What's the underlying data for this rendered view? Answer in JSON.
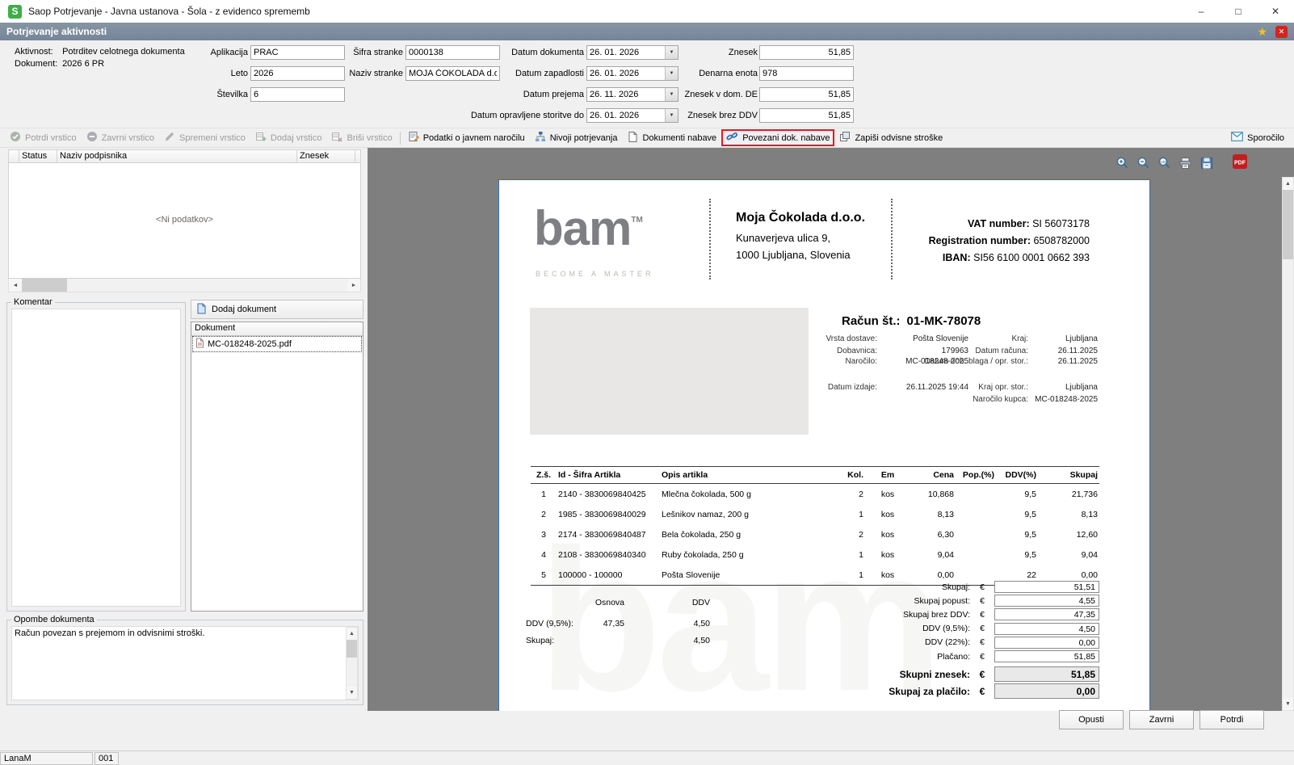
{
  "window": {
    "title": "Saop Potrjevanje - Javna ustanova - Šola - z evidenco sprememb",
    "app_initial": "S"
  },
  "header": {
    "title": "Potrjevanje aktivnosti"
  },
  "icons": {
    "minimize": "–",
    "maximize": "□",
    "close": "✕",
    "star": "★",
    "exit": "✕",
    "dropdown": "▼",
    "up": "▲",
    "down": "▼",
    "left": "◄",
    "right": "►"
  },
  "form": {
    "aktivnost_label": "Aktivnost:",
    "aktivnost": "Potrditev celotnega dokumenta",
    "dokument_label": "Dokument:",
    "dokument": "2026 6 PR",
    "aplikacija_label": "Aplikacija",
    "aplikacija": "PRAC",
    "leto_label": "Leto",
    "leto": "2026",
    "stevilka_label": "Številka",
    "stevilka": "6",
    "sifra_stranke_label": "Šifra stranke",
    "sifra_stranke": "0000138",
    "naziv_stranke_label": "Naziv stranke",
    "naziv_stranke": "MOJA ČOKOLADA d.o.o",
    "datum_dokumenta_label": "Datum dokumenta",
    "datum_dokumenta": "26. 01. 2026",
    "datum_zapadlosti_label": "Datum zapadlosti",
    "datum_zapadlosti": "26. 01. 2026",
    "datum_prejema_label": "Datum prejema",
    "datum_prejema": "26. 11. 2026",
    "datum_storitve_label": "Datum opravljene storitve do",
    "datum_storitve": "26. 01. 2026",
    "znesek_label": "Znesek",
    "znesek": "51,85",
    "denarna_enota_label": "Denarna enota",
    "denarna_enota": "978",
    "znesek_dom_label": "Znesek v dom. DE",
    "znesek_dom": "51,85",
    "znesek_brez_ddv_label": "Znesek brez DDV",
    "znesek_brez_ddv": "51,85"
  },
  "toolbar": {
    "potrdi_vrstico": "Potrdi vrstico",
    "zavrni_vrstico": "Zavrni vrstico",
    "spremeni_vrstico": "Spremeni vrstico",
    "dodaj_vrstico": "Dodaj vrstico",
    "brisi_vrstico": "Briši vrstico",
    "podatki_narocilo": "Podatki o javnem naročilu",
    "nivoji": "Nivoji potrjevanja",
    "dokumenti_nabave": "Dokumenti nabave",
    "povezani_dok": "Povezani dok. nabave",
    "zapisi_stroske": "Zapiši odvisne stroške",
    "sporocilo": "Sporočilo"
  },
  "signers": {
    "columns": [
      "Status",
      "Naziv podpisnika",
      "Znesek"
    ],
    "empty_text": "<Ni podatkov>"
  },
  "komentar": {
    "label": "Komentar"
  },
  "documents": {
    "add_button": "Dodaj dokument",
    "column": "Dokument",
    "items": [
      "MC-018248-2025.pdf"
    ]
  },
  "opombe": {
    "label": "Opombe dokumenta",
    "text": "Račun povezan s prejemom in odvisnimi stroški."
  },
  "invoice": {
    "logo_text": "bam",
    "logo_tm": "TM",
    "logo_tagline": "BECOME A MASTER",
    "company": {
      "name": "Moja Čokolada d.o.o.",
      "street": "Kunaverjeva ulica 9,",
      "city": "1000 Ljubljana, Slovenia"
    },
    "ids": {
      "vat_label": "VAT number:",
      "vat": "SI 56073178",
      "reg_label": "Registration number:",
      "reg": "6508782000",
      "iban_label": "IBAN:",
      "iban": "SI56 6100 0001 0662 393"
    },
    "title_label": "Račun št.:",
    "number": "01-MK-78078",
    "meta_left": [
      {
        "label": "Vrsta dostave:",
        "value": "Pošta Slovenije"
      },
      {
        "label": "Dobavnica:",
        "value": "179963"
      },
      {
        "label": "Naročilo:",
        "value": "MC-018248-2025"
      },
      {
        "label": "Datum izdaje:",
        "value": "26.11.2025 19:44"
      }
    ],
    "meta_right": [
      {
        "label": "Kraj:",
        "value": "Ljubljana"
      },
      {
        "label": "Datum računa:",
        "value": "26.11.2025"
      },
      {
        "label": "Datum dob. blaga / opr. stor.:",
        "value": "26.11.2025"
      },
      {
        "label": "Kraj opr. stor.:",
        "value": "Ljubljana"
      },
      {
        "label": "Naročilo kupca:",
        "value": "MC-018248-2025"
      }
    ],
    "table": {
      "headers": [
        "Z.š.",
        "Id - Šifra Artikla",
        "Opis artikla",
        "Kol.",
        "Em",
        "Cena",
        "Pop.(%)",
        "DDV(%)",
        "Skupaj"
      ],
      "rows": [
        [
          "1",
          "2140 - 3830069840425",
          "Mlečna čokolada, 500 g",
          "2",
          "kos",
          "10,868",
          "",
          "9,5",
          "21,736"
        ],
        [
          "2",
          "1985 - 3830069840029",
          "Lešnikov namaz, 200 g",
          "1",
          "kos",
          "8,13",
          "",
          "9,5",
          "8,13"
        ],
        [
          "3",
          "2174 - 3830069840487",
          "Bela čokolada, 250 g",
          "2",
          "kos",
          "6,30",
          "",
          "9,5",
          "12,60"
        ],
        [
          "4",
          "2108 - 3830069840340",
          "Ruby čokolada, 250 g",
          "1",
          "kos",
          "9,04",
          "",
          "9,5",
          "9,04"
        ],
        [
          "5",
          "100000 - 100000",
          "Pošta Slovenije",
          "1",
          "kos",
          "0,00",
          "",
          "22",
          "0,00"
        ]
      ]
    },
    "vat_summary": {
      "osnova_header": "Osnova",
      "ddv_header": "DDV",
      "rows": [
        {
          "label": "DDV (9,5%):",
          "osnova": "47,35",
          "ddv": "4,50"
        },
        {
          "label": "Skupaj:",
          "osnova": "",
          "ddv": "4,50"
        }
      ]
    },
    "totals": [
      {
        "label": "Skupaj:",
        "currency": "€",
        "value": "51,51"
      },
      {
        "label": "Skupaj popust:",
        "currency": "€",
        "value": "4,55"
      },
      {
        "label": "Skupaj brez DDV:",
        "currency": "€",
        "value": "47,35"
      },
      {
        "label": "DDV (9,5%):",
        "currency": "€",
        "value": "4,50"
      },
      {
        "label": "DDV (22%):",
        "currency": "€",
        "value": "0,00"
      },
      {
        "label": "Plačano:",
        "currency": "€",
        "value": "51,85"
      },
      {
        "label": "Skupni znesek:",
        "currency": "€",
        "value": "51,85"
      },
      {
        "label": "Skupaj za plačilo:",
        "currency": "€",
        "value": "0,00"
      }
    ]
  },
  "actions": {
    "opusti": "Opusti",
    "zavrni": "Zavrni",
    "potrdi": "Potrdi"
  },
  "statusbar": {
    "user": "LanaM",
    "code": "001"
  }
}
